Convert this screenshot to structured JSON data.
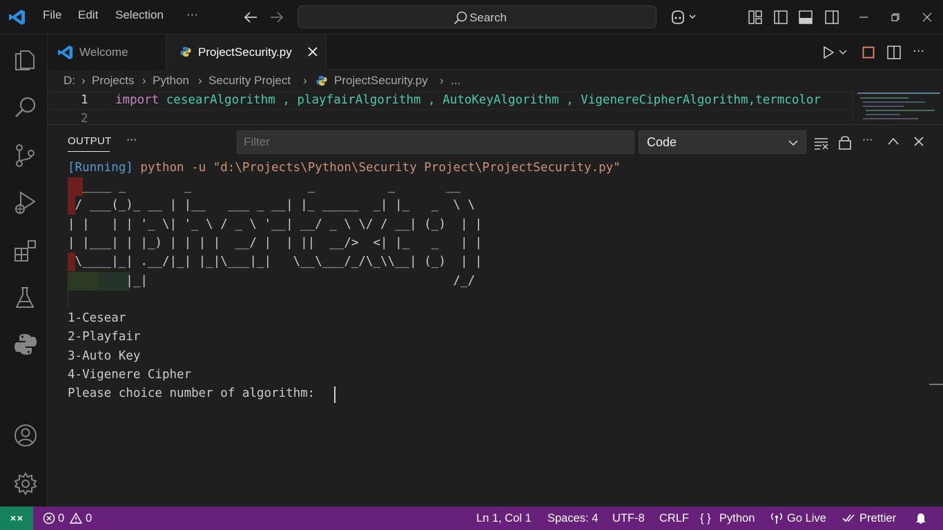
{
  "menu": {
    "file": "File",
    "edit": "Edit",
    "selection": "Selection",
    "more": "···"
  },
  "search": {
    "label": "Search"
  },
  "tabs": [
    {
      "label": "Welcome"
    },
    {
      "label": "ProjectSecurity.py"
    }
  ],
  "breadcrumbs": [
    "D:",
    "Projects",
    "Python",
    "Security Project",
    "ProjectSecurity.py",
    "..."
  ],
  "editor": {
    "lines": [
      {
        "number": "1",
        "keyword": "import",
        "text": " cesearAlgorithm , playfairAlgorithm , AutoKeyAlgorithm , VigenereCipherAlgorithm,termcolor"
      },
      {
        "number": "2",
        "keyword": "",
        "text": ""
      }
    ]
  },
  "panel": {
    "tab": "OUTPUT",
    "more": "···",
    "filter_placeholder": "Filter",
    "channel": "Code",
    "running": "[Running]",
    "command": " python -u \"d:\\Projects\\Python\\Security Project\\ProjectSecurity.py\"",
    "ascii_art": [
      "  ____ _        _                _          _       __",
      " / ___(_)_ __ | |__   ___ _ __| |_ _____  _| |_   _  \\ \\",
      "| |   | | '_ \\| '_ \\ / _ \\ '__| __/ _ \\ \\/ / __| (_)  | |",
      "| |___| | |_) | | | |  __/ |  | ||  __/>  <| |_   _   | |",
      " \\____|_| .__/|_| |_|\\___|_|   \\__\\___/_/\\_\\\\__| (_)  | |",
      "        |_|                                          /_/"
    ],
    "menu_items": [
      "1-Cesear",
      "2-Playfair",
      "3-Auto Key",
      "4-Vigenere Cipher"
    ],
    "prompt": "Please choice number of algorithm: "
  },
  "status": {
    "errors": "0",
    "warnings": "0",
    "position": "Ln 1, Col 1",
    "spaces": "Spaces: 4",
    "encoding": "UTF-8",
    "eol": "CRLF",
    "language": "Python",
    "golive": "Go Live",
    "prettier": "Prettier"
  },
  "colors": {
    "accent": "#0078d4",
    "status_bar": "#68217a",
    "keyword": "#c586c0",
    "module": "#4ec9b0",
    "running": "#569cd6",
    "command": "#ce9178"
  }
}
